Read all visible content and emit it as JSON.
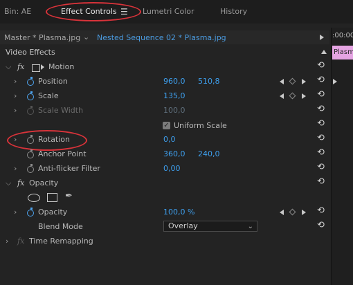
{
  "tabs": {
    "bin": "Bin: AE",
    "effect_controls": "Effect Controls",
    "menu_icon": "hamburger-menu-icon",
    "lumetri": "Lumetri Color",
    "history": "History"
  },
  "sequence": {
    "master": "Master * Plasma.jpg",
    "nested": "Nested Sequence 02 * Plasma.jpg"
  },
  "timeline": {
    "time": ":00:00",
    "clip": "Plasma"
  },
  "section_title": "Video Effects",
  "motion": {
    "label": "Motion",
    "position": {
      "label": "Position",
      "x": "960,0",
      "y": "510,8"
    },
    "scale": {
      "label": "Scale",
      "value": "135,0"
    },
    "scale_width": {
      "label": "Scale Width",
      "value": "100,0"
    },
    "uniform_scale": {
      "label": "Uniform Scale",
      "checked": true
    },
    "rotation": {
      "label": "Rotation",
      "value": "0,0"
    },
    "anchor_point": {
      "label": "Anchor Point",
      "x": "360,0",
      "y": "240,0"
    },
    "anti_flicker": {
      "label": "Anti-flicker Filter",
      "value": "0,00"
    }
  },
  "opacity": {
    "label": "Opacity",
    "opacity_prop": {
      "label": "Opacity",
      "value": "100,0 %"
    },
    "blend_mode": {
      "label": "Blend Mode",
      "value": "Overlay"
    }
  },
  "time_remapping": {
    "label": "Time Remapping"
  },
  "colors": {
    "value_blue": "#3ea0ef",
    "annotation_red": "#d9333a",
    "clip_pink": "#e5a4e3"
  }
}
